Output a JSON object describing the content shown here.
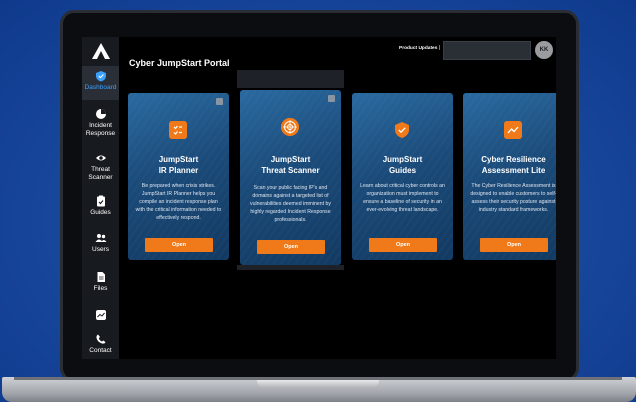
{
  "header": {
    "portal_title": "Cyber JumpStart Portal",
    "product_updates": "Product Updates",
    "separator": "|",
    "avatar_initials": "KK"
  },
  "sidebar": {
    "items": [
      {
        "label": "Dashboard",
        "icon": "shield-icon",
        "active": true
      },
      {
        "label": "Incident Response",
        "icon": "pie-chart-icon",
        "active": false
      },
      {
        "label": "Threat Scanner",
        "icon": "eye-icon",
        "active": false
      },
      {
        "label": "Guides",
        "icon": "clipboard-check-icon",
        "active": false
      },
      {
        "label": "Users",
        "icon": "users-icon",
        "active": false
      },
      {
        "label": "Files",
        "icon": "file-icon",
        "active": false
      },
      {
        "label": "",
        "icon": "chart-icon",
        "active": false
      },
      {
        "label": "Contact",
        "icon": "contact-icon",
        "active": false
      }
    ]
  },
  "cards": [
    {
      "title_1": "JumpStart",
      "title_2": "IR Planner",
      "desc": "Be prepared when crisis strikes. JumpStart IR Planner helps you compile an incident response plan with the critical information needed to effectively respond.",
      "button": "Open",
      "icon": "checklist-icon"
    },
    {
      "title_1": "JumpStart",
      "title_2": "Threat Scanner",
      "desc": "Scan your public facing IP's and domains against a targeted list of vulnerabilities deemed imminent by highly regarded Incident Response professionals.",
      "button": "Open",
      "icon": "target-icon"
    },
    {
      "title_1": "JumpStart",
      "title_2": "Guides",
      "desc": "Learn about critical cyber controls an organization must implement to ensure a baseline of security in an ever-evolving threat landscape.",
      "button": "Open",
      "icon": "shield-check-icon"
    },
    {
      "title_1": "Cyber Resilience",
      "title_2": "Assessment Lite",
      "desc": "The Cyber Resilience Assessment is designed to enable customers to self-assess their security posture against industry standard frameworks.",
      "button": "Open",
      "icon": "trend-icon"
    }
  ],
  "colors": {
    "accent": "#f07a1a",
    "active_nav": "#3aa0ff",
    "background": "#1a4aa0"
  }
}
